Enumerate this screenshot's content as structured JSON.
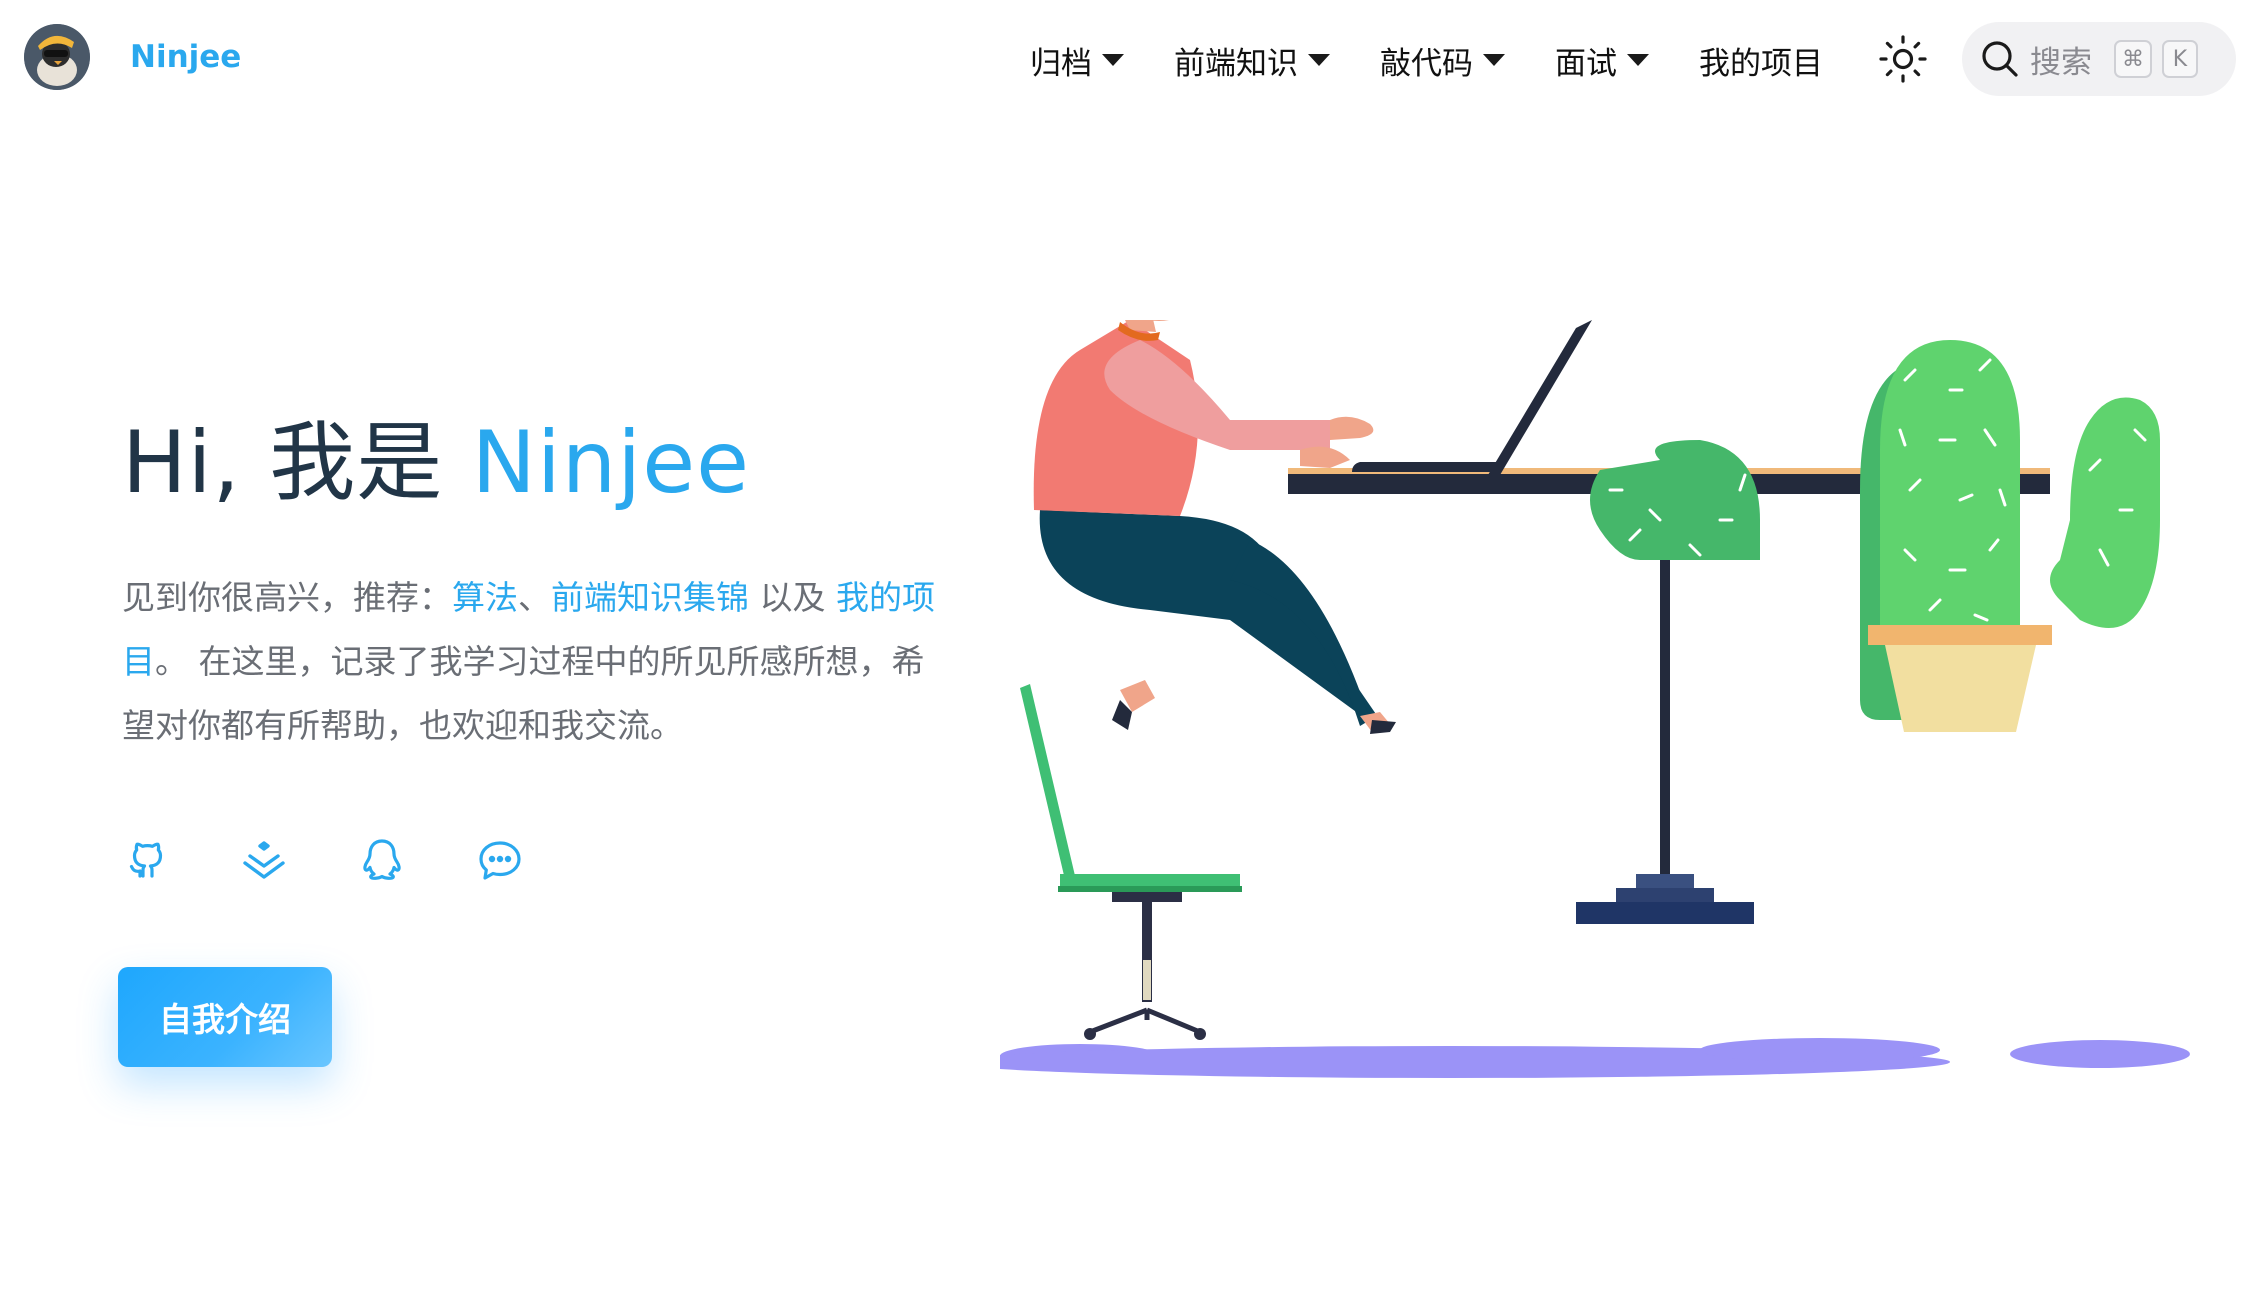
{
  "header": {
    "site_title": "Ninjee",
    "nav": [
      {
        "label": "归档",
        "has_dropdown": true
      },
      {
        "label": "前端知识",
        "has_dropdown": true
      },
      {
        "label": "敲代码",
        "has_dropdown": true
      },
      {
        "label": "面试",
        "has_dropdown": true
      },
      {
        "label": "我的项目",
        "has_dropdown": false
      }
    ],
    "theme_toggle_icon": "sun-icon",
    "search": {
      "label": "搜索",
      "shortcut": [
        "⌘",
        "K"
      ]
    }
  },
  "hero": {
    "title_prefix": "Hi, 我是 ",
    "title_name": "Ninjee",
    "desc": {
      "part1": "见到你很高兴，推荐：",
      "link_algorithms": "算法",
      "sep": "、",
      "link_frontend": "前端知识集锦",
      "part2": " 以及 ",
      "link_projects": "我的项目",
      "part3": "。 在这里，记录了我学习过程中的所见所感所想，希望对你都有所帮助，也欢迎和我交流。"
    },
    "socials": [
      "github-icon",
      "juejin-icon",
      "qq-icon",
      "wechat-icon"
    ],
    "intro_button": "自我介绍"
  },
  "colors": {
    "accent": "#2aa8ee",
    "text": "#213547",
    "muted": "#6a6e75"
  }
}
